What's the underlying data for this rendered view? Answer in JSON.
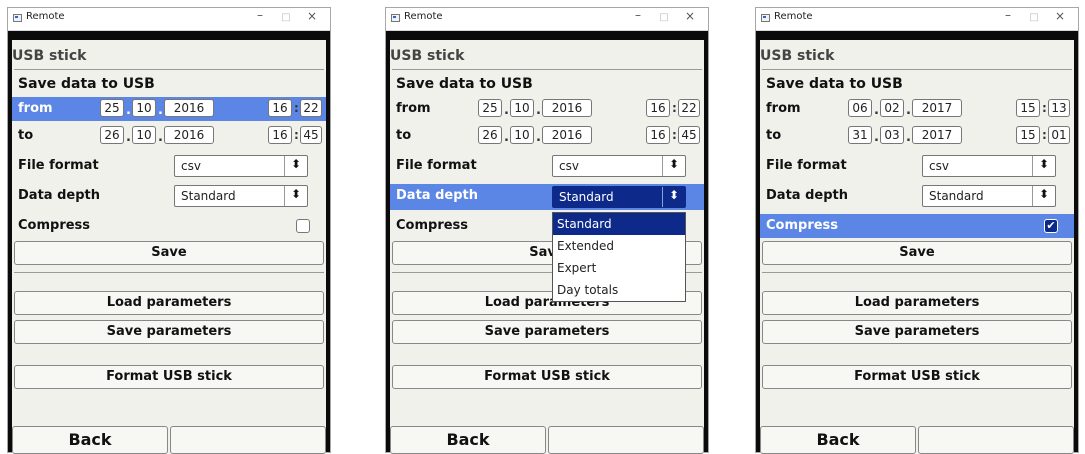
{
  "window_title": "Remote",
  "window_controls": {
    "minimize": "–",
    "maximize": "□",
    "close": "×"
  },
  "screen": {
    "header": "USB stick",
    "section": "Save data to USB",
    "from_label": "from",
    "to_label": "to",
    "file_format_label": "File format",
    "data_depth_label": "Data depth",
    "compress_label": "Compress",
    "save": "Save",
    "load_parameters": "Load parameters",
    "save_parameters": "Save parameters",
    "format_usb": "Format USB stick",
    "back": "Back",
    "date_sep": ".",
    "time_sep": ":"
  },
  "windows": [
    {
      "selected_row": "from",
      "from": {
        "day": "25",
        "month": "10",
        "year": "2016",
        "hour": "16",
        "minute": "22"
      },
      "to": {
        "day": "26",
        "month": "10",
        "year": "2016",
        "hour": "16",
        "minute": "45"
      },
      "file_format": "csv",
      "data_depth": "Standard",
      "compress": false
    },
    {
      "selected_row": "data_depth",
      "from": {
        "day": "25",
        "month": "10",
        "year": "2016",
        "hour": "16",
        "minute": "22"
      },
      "to": {
        "day": "26",
        "month": "10",
        "year": "2016",
        "hour": "16",
        "minute": "45"
      },
      "file_format": "csv",
      "data_depth": "Standard",
      "dropdown_options": [
        "Standard",
        "Extended",
        "Expert",
        "Day totals"
      ],
      "dropdown_selected": "Standard"
    },
    {
      "selected_row": "compress",
      "from": {
        "day": "06",
        "month": "02",
        "year": "2017",
        "hour": "15",
        "minute": "13"
      },
      "to": {
        "day": "31",
        "month": "03",
        "year": "2017",
        "hour": "15",
        "minute": "01"
      },
      "file_format": "csv",
      "data_depth": "Standard",
      "compress": true
    }
  ],
  "colors": {
    "selection_row": "#5b86e6",
    "selection_dark": "#0d2a8a",
    "panel": "#f1f1ec"
  }
}
